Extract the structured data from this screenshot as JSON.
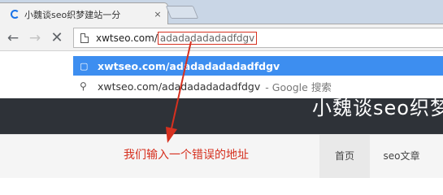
{
  "browser": {
    "tab": {
      "title": "小魏谈seo织梦建站一分",
      "close_glyph": "×"
    },
    "toolbar": {
      "back_glyph": "←",
      "forward_glyph": "→",
      "stop_glyph": "✕",
      "url_host": "xwtseo.com/",
      "url_selected": "adadadadadadfdgv"
    },
    "suggestions": [
      {
        "icon": "page-icon",
        "text": "xwtseo.com/adadadadadadfdgv",
        "suffix": ""
      },
      {
        "icon": "search-icon",
        "text": "xwtseo.com/adadadadadadfdgv",
        "suffix": "- Google 搜索"
      }
    ]
  },
  "site": {
    "title": "小魏谈seo织梦",
    "nav": [
      "首页",
      "seo文章"
    ]
  },
  "annotation": {
    "text": "我们输入一个错误的地址",
    "color": "#d6301f"
  },
  "colors": {
    "accent": "#3d8ef0",
    "header_bg": "#2e3238",
    "annotation": "#d6301f"
  }
}
